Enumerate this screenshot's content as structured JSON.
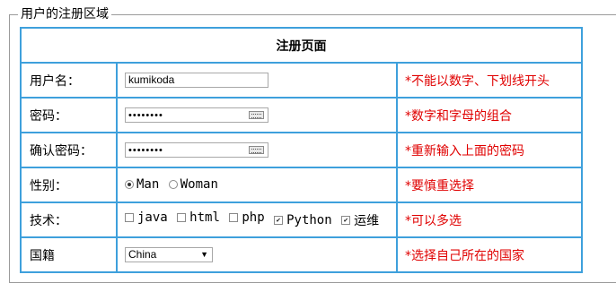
{
  "legend": "用户的注册区域",
  "form": {
    "title": "注册页面",
    "username": {
      "label": "用户名：",
      "value": "kumikoda",
      "hint": "*不能以数字、下划线开头"
    },
    "password": {
      "label": "密码：",
      "value": "••••••••",
      "hint": "*数字和字母的组合"
    },
    "confirm": {
      "label": "确认密码：",
      "value": "••••••••",
      "hint": "*重新输入上面的密码"
    },
    "gender": {
      "label": "性别：",
      "options": [
        {
          "label": "Man",
          "selected": true
        },
        {
          "label": "Woman",
          "selected": false
        }
      ],
      "hint": "*要慎重选择"
    },
    "tech": {
      "label": "技术：",
      "options": [
        {
          "label": "java",
          "checked": false
        },
        {
          "label": "html",
          "checked": false
        },
        {
          "label": "php",
          "checked": false
        },
        {
          "label": "Python",
          "checked": true
        },
        {
          "label": "运维",
          "checked": true
        }
      ],
      "hint": "*可以多选"
    },
    "country": {
      "label": "国籍",
      "value": "China",
      "hint": "*选择自己所在的国家"
    }
  },
  "colors": {
    "border": "#3ea0dc",
    "hint": "#e00000"
  }
}
